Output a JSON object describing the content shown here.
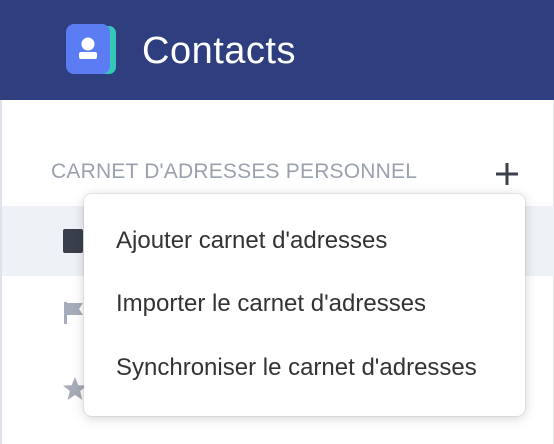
{
  "header": {
    "title": "Contacts",
    "icon": "contact-card-icon",
    "background_color": "#2f3e7e"
  },
  "sidebar": {
    "section_title": "CARNET D'ADRESSES PERSONNEL",
    "add_icon": "plus-icon",
    "rows": [
      {
        "icon": "address-book-icon",
        "selected": true
      },
      {
        "icon": "flag-icon",
        "selected": false
      },
      {
        "icon": "star-icon",
        "selected": false
      }
    ]
  },
  "dropdown": {
    "items": [
      {
        "label": "Ajouter carnet d'adresses"
      },
      {
        "label": "Importer le carnet d'adresses"
      },
      {
        "label": "Synchroniser le carnet d'adresses"
      }
    ]
  }
}
